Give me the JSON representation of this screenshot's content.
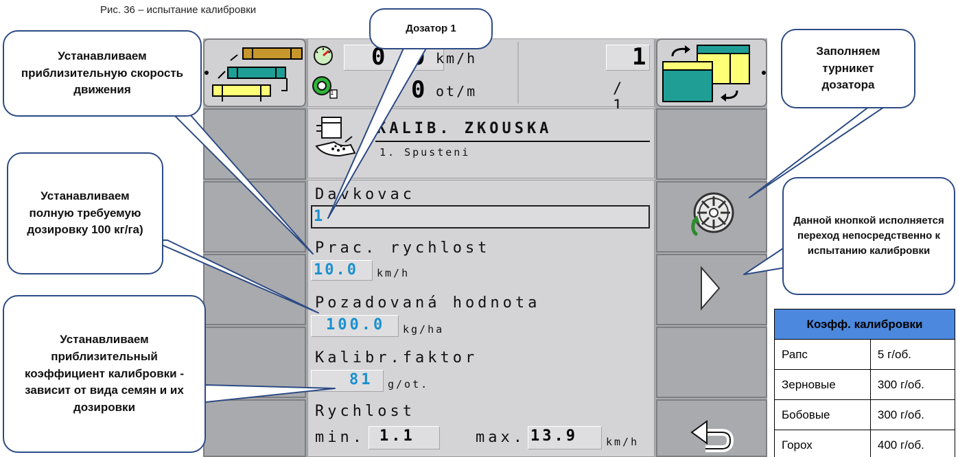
{
  "caption": "Рис. 36 – испытание калибровки",
  "header": {
    "speed_value_a": "0",
    "speed_value_b": "0",
    "speed_unit": "km/h",
    "rev_value": "0",
    "rev_unit": "ot/m",
    "counter_top": "1",
    "counter_bottom": "/ 1",
    "small_marker": "1"
  },
  "screen": {
    "title": "KALIB. ZKOUSKA",
    "subtitle": "1. Spusteni",
    "dosing_label": "Davkovac",
    "dosing_value": "1",
    "speed_label": "Prac. rychlost",
    "speed_value": "10.0",
    "speed_unit": "km/h",
    "rate_label": "Pozadovaná hodnota",
    "rate_value": "100.0",
    "rate_unit": "kg/ha",
    "factor_label": "Kalibr.faktor",
    "factor_value": "81",
    "factor_unit": "g/ot.",
    "range_label": "Rychlost",
    "min_label": "min.",
    "min_value": "1.1",
    "max_label": "max.",
    "max_value": "13.9",
    "range_unit": "km/h"
  },
  "callouts": {
    "speed": "Устанавливаем приблизительную скорость движения",
    "dosing": "Дозатор 1",
    "rate": "Устанавливаем полную требуемую дозировку 100 кг/га)",
    "factor": "Устанавливаем приблизительный коэффициент калибровки - зависит от вида семян и их дозировки",
    "fill": "Заполняем турникет дозатора",
    "next": "Данной кнопкой исполняется переход непосредственно к испытанию калибровки"
  },
  "table": {
    "header": "Коэфф. калибровки",
    "rows": [
      {
        "crop": "Рапс",
        "value": "5 г/об."
      },
      {
        "crop": "Зерновые",
        "value": "300 г/об."
      },
      {
        "crop": "Бобовые",
        "value": "300 г/об."
      },
      {
        "crop": "Горох",
        "value": "400 г/об."
      }
    ]
  },
  "colors": {
    "terminal_gray": "#a9aaad",
    "screen_gray": "#d1d1d3",
    "value_blue": "#1a90d0",
    "callout_border": "#2c4a84",
    "table_header": "#4b88de",
    "teal": "#1f9e96",
    "yellow": "#ffff77"
  }
}
